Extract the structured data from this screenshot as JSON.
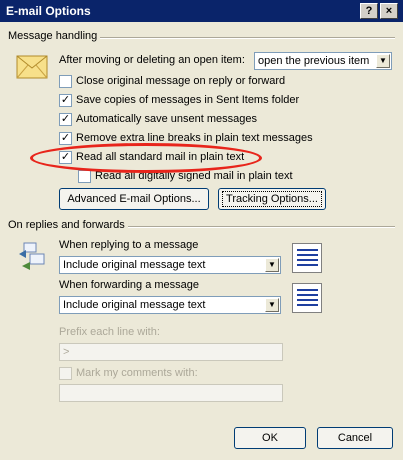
{
  "window": {
    "title": "E-mail Options",
    "help_label": "?",
    "close_label": "×"
  },
  "message_handling": {
    "label": "Message handling",
    "after_moving_label": "After moving or deleting an open item:",
    "after_moving_value": "open the previous item",
    "checkboxes": [
      {
        "label": "Close original message on reply or forward",
        "checked": ""
      },
      {
        "label": "Save copies of messages in Sent Items folder",
        "checked": "✓"
      },
      {
        "label": "Automatically save unsent messages",
        "checked": "✓"
      },
      {
        "label": "Remove extra line breaks in plain text messages",
        "checked": "✓"
      },
      {
        "label": "Read all standard mail in plain text",
        "checked": "✓"
      },
      {
        "label": "Read all digitally signed mail in plain text",
        "checked": ""
      }
    ],
    "advanced_button": "Advanced E-mail Options...",
    "tracking_button": "Tracking Options..."
  },
  "replies_forwards": {
    "label": "On replies and forwards",
    "replying_label": "When replying to a message",
    "replying_value": "Include original message text",
    "forwarding_label": "When forwarding a message",
    "forwarding_value": "Include original message text",
    "prefix_label": "Prefix each line with:",
    "prefix_value": ">",
    "mark_comments_label": "Mark my comments with:",
    "mark_comments_value": ""
  },
  "footer": {
    "ok_label": "OK",
    "cancel_label": "Cancel"
  },
  "colors": {
    "titlebar": "#0a246a",
    "dialog": "#ece9d8",
    "annotation": "#e8251b"
  }
}
